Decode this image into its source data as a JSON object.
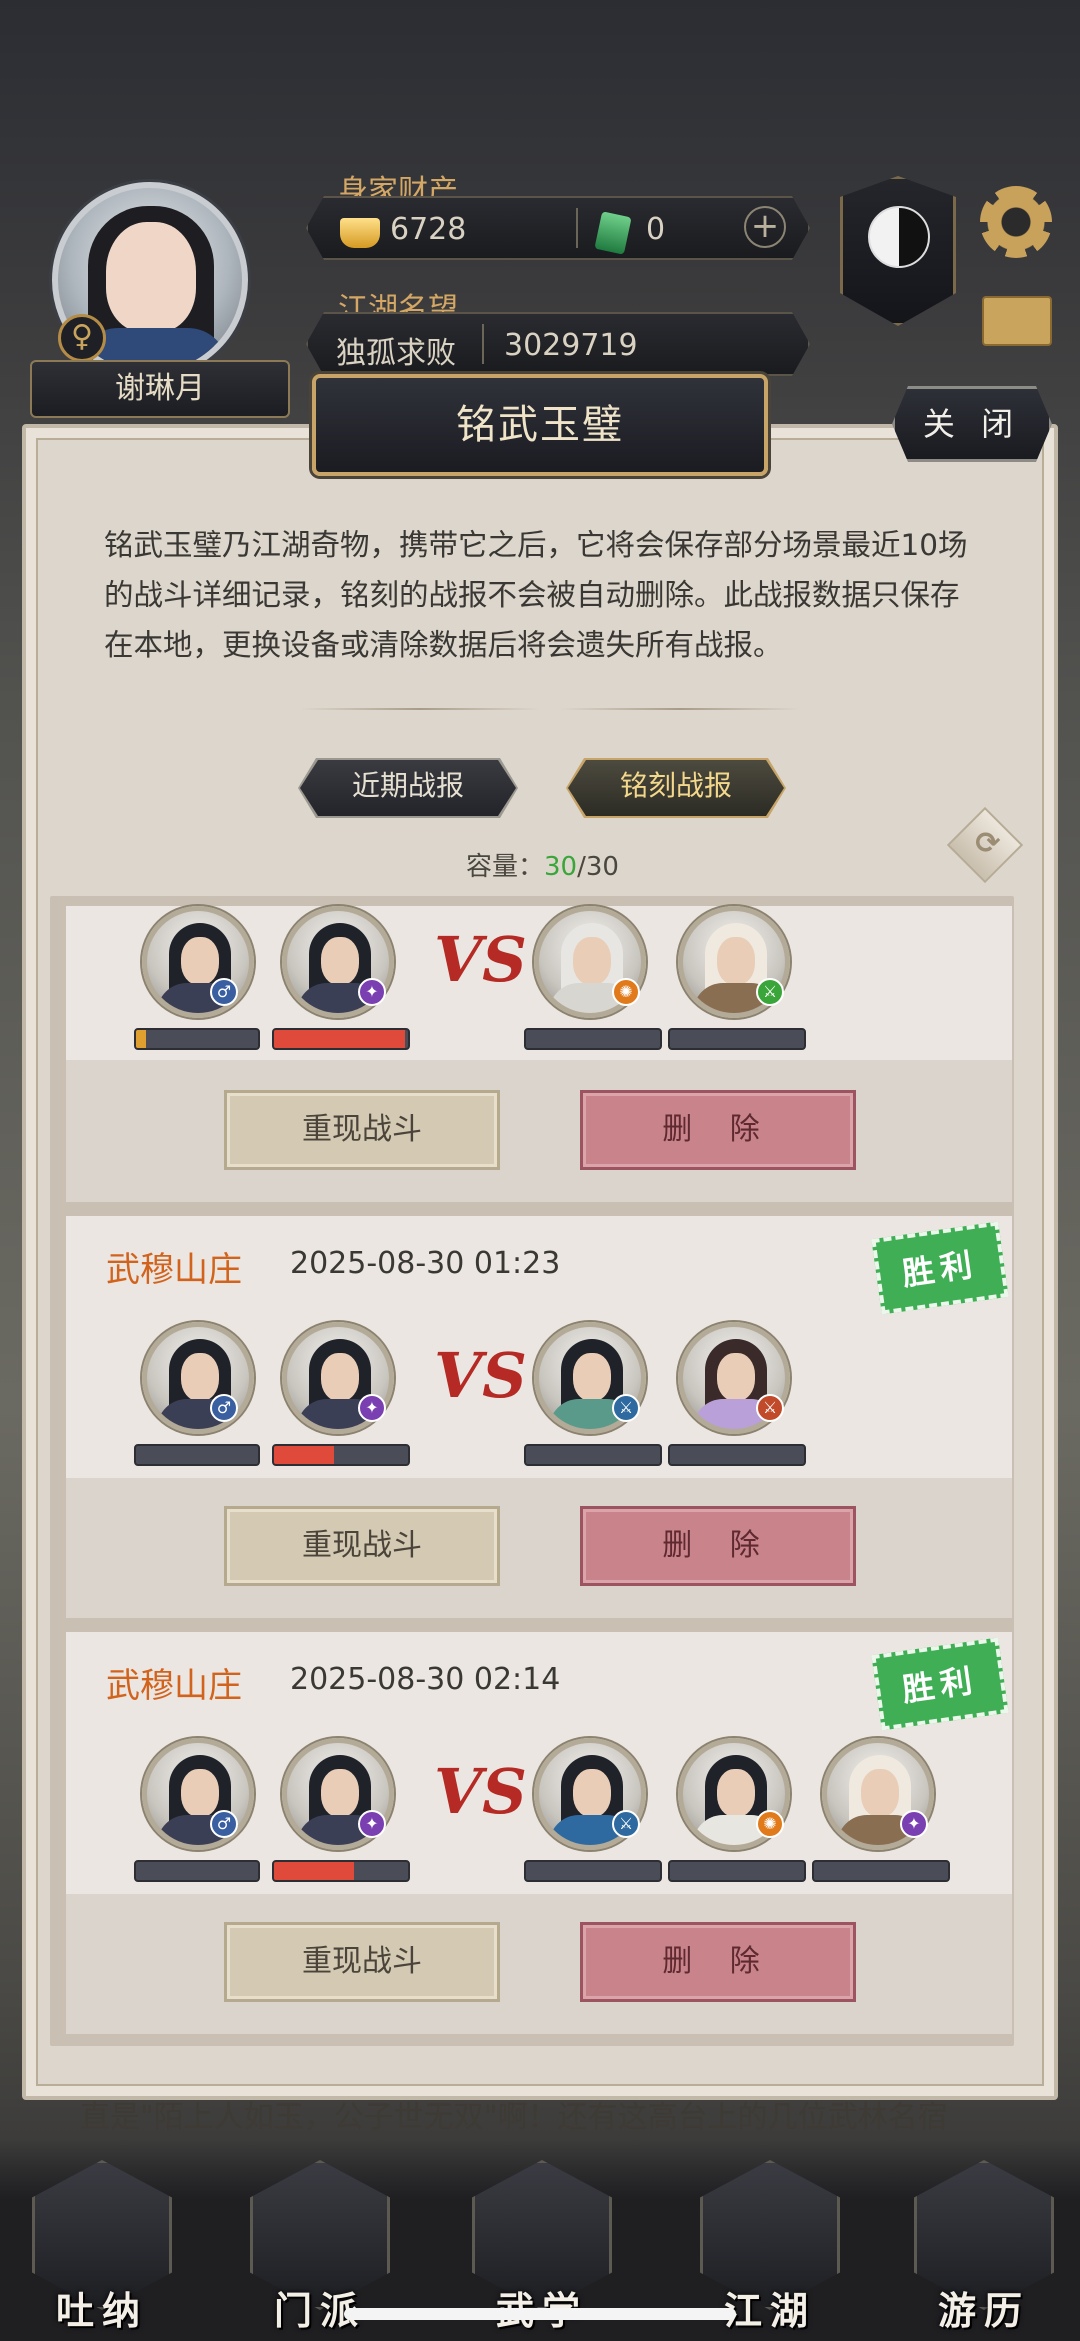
{
  "player": {
    "name": "谢琳月",
    "gender_symbol": "♀",
    "assets_label": "身家财产",
    "gold": "6728",
    "jade": "0",
    "reputation_label": "江湖名望",
    "title": "独孤求败",
    "reputation": "3029719"
  },
  "modal": {
    "title": "铭武玉璧",
    "close_label": "关 闭",
    "description": "铭武玉璧乃江湖奇物，携带它之后，它将会保存部分场景最近10场的战斗详细记录，铭刻的战报不会被自动删除。此战报数据只保存在本地，更换设备或清除数据后将会遗失所有战报。",
    "tabs": [
      {
        "label": "近期战报",
        "active": false
      },
      {
        "label": "铭刻战报",
        "active": true
      }
    ],
    "capacity_label": "容量：",
    "capacity_used": "30",
    "capacity_total": "/30"
  },
  "records": [
    {
      "location": "",
      "time": "",
      "result": "",
      "team_hp": [
        0.08,
        0.98
      ],
      "enemy_hp": [
        0.0,
        0.0
      ],
      "replay_label": "重现战斗",
      "delete_label": "删 除"
    },
    {
      "location": "武穆山庄",
      "time": "2025-08-30 01:23",
      "result": "胜利",
      "team_hp": [
        0.0,
        0.45
      ],
      "enemy_hp": [
        0.0,
        0.0
      ],
      "replay_label": "重现战斗",
      "delete_label": "删 除"
    },
    {
      "location": "武穆山庄",
      "time": "2025-08-30 02:14",
      "result": "胜利",
      "team_hp": [
        0.0,
        0.6
      ],
      "enemy_hp": [
        0.0,
        0.0,
        0.0
      ],
      "replay_label": "重现战斗",
      "delete_label": "删 除"
    }
  ],
  "vs_label": "VS",
  "background_text": "直是\"陌上人如玉，公子世无双\"啊！还有这高台上的几位武林名宿",
  "nav": [
    {
      "label": "吐纳"
    },
    {
      "label": "门派"
    },
    {
      "label": "武学"
    },
    {
      "label": "江湖"
    },
    {
      "label": "游历"
    }
  ],
  "colors": {
    "accent_gold": "#c8a468",
    "location_orange": "#d2631d",
    "hp_gold": "#e0a030",
    "hp_red": "#e04a3a",
    "capacity_green": "#3aa63a",
    "victory_green": "#3fae55",
    "delete_red": "#c9838a"
  }
}
